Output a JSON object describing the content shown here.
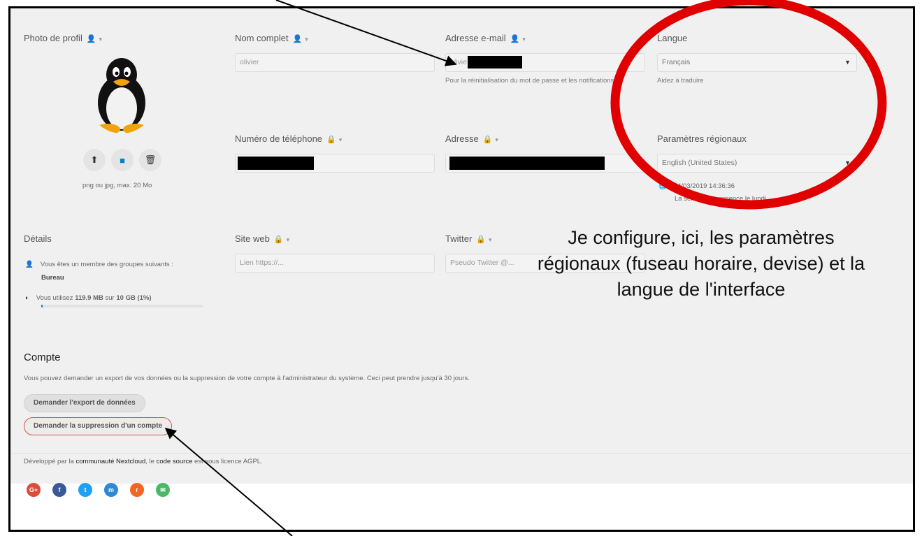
{
  "profile": {
    "photo_label": "Photo de profil",
    "photo_hint": "png ou jpg, max. 20 Mo",
    "full_name": {
      "label": "Nom complet",
      "value": "olivier"
    },
    "email": {
      "label": "Adresse e-mail",
      "value": "olivie",
      "hint": "Pour la réinitialisation du mot de passe et les notifications"
    },
    "language": {
      "label": "Langue",
      "value": "Français",
      "help_link": "Aidez à traduire"
    },
    "phone": {
      "label": "Numéro de téléphone"
    },
    "address": {
      "label": "Adresse"
    },
    "locale": {
      "label": "Paramètres régionaux",
      "value": "English (United States)",
      "datetime": "14/03/2019 14:36:36",
      "week_start": "La semaine commence le lundi"
    },
    "website": {
      "label": "Site web",
      "placeholder": "Lien https://..."
    },
    "twitter": {
      "label": "Twitter",
      "placeholder": "Pseudo Twitter @..."
    }
  },
  "details": {
    "title": "Détails",
    "groups_text": "Vous êtes un membre des groupes suivants :",
    "groups_value": "Bureau",
    "usage_prefix": "Vous utilisez",
    "usage_used": "119.9 MB",
    "usage_mid": "sur",
    "usage_total": "10 GB",
    "usage_pct": "(1%)",
    "usage_fraction": 0.01
  },
  "account": {
    "title": "Compte",
    "description": "Vous pouvez demander un export de vos données ou la suppression de votre compte à l'administrateur du système. Ceci peut prendre jusqu'à 30 jours.",
    "export_button": "Demander l'export de données",
    "delete_button": "Demander la suppression d'un compte"
  },
  "footer": {
    "text_prefix": "Développé par la",
    "community_link": "communauté Nextcloud",
    "text_mid": ", le",
    "source_link": "code source",
    "text_suffix": "est sous licence AGPL.",
    "social": [
      {
        "name": "google-plus-icon",
        "glyph": "G+",
        "color": "#dd4b39"
      },
      {
        "name": "facebook-icon",
        "glyph": "f",
        "color": "#3b5998"
      },
      {
        "name": "twitter-icon",
        "glyph": "t",
        "color": "#1da1f2"
      },
      {
        "name": "mastodon-icon",
        "glyph": "m",
        "color": "#3088d4"
      },
      {
        "name": "rss-icon",
        "glyph": "r",
        "color": "#f26522"
      },
      {
        "name": "mail-icon",
        "glyph": "✉",
        "color": "#4ab866"
      }
    ]
  },
  "annotation": {
    "line1": "Je configure, ici, les paramètres",
    "line2": "régionaux (fuseau horaire, devise) et la",
    "line3": "langue de l'interface"
  },
  "colors": {
    "highlight_circle": "#e00000",
    "progress": "#0082c9"
  }
}
